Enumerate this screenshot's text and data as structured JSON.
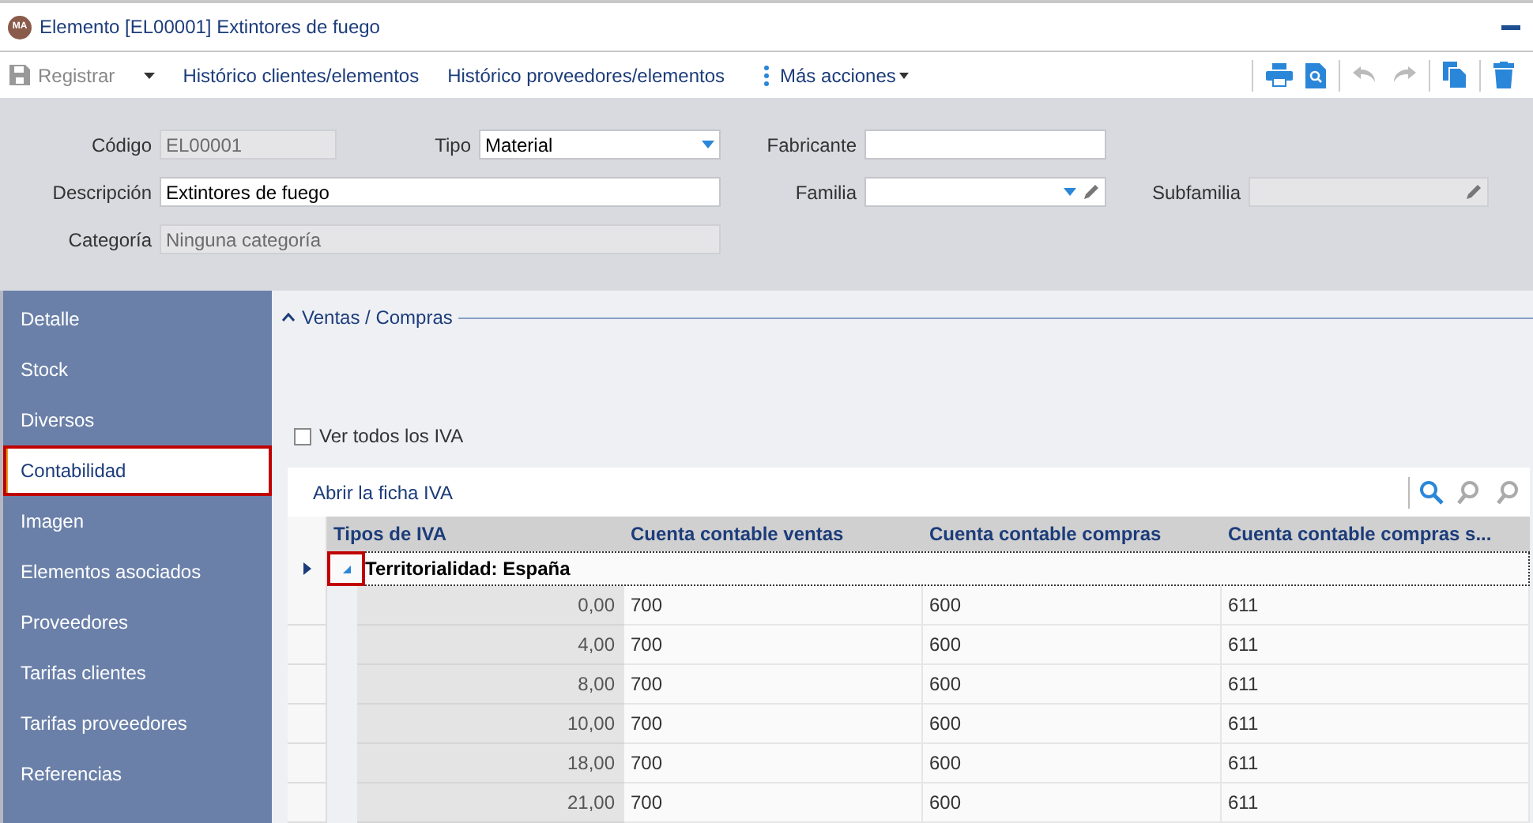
{
  "window": {
    "title": "Elemento [EL00001] Extintores de fuego",
    "avatar": "MA"
  },
  "toolbar": {
    "register": "Registrar",
    "actions": [
      "Histórico clientes/elementos",
      "Histórico proveedores/elementos"
    ],
    "more": "Más acciones"
  },
  "form": {
    "codigo": {
      "label": "Código",
      "value": "EL00001",
      "disabled": true
    },
    "tipo": {
      "label": "Tipo",
      "value": "Material"
    },
    "fabricante": {
      "label": "Fabricante"
    },
    "descripcion": {
      "label": "Descripción",
      "value": "Extintores de fuego"
    },
    "familia": {
      "label": "Familia"
    },
    "subfamilia": {
      "label": "Subfamilia",
      "disabled": true
    },
    "categoria": {
      "label": "Categoría",
      "value": "Ninguna categoría",
      "disabled": true
    }
  },
  "sidebar": {
    "items": [
      {
        "label": "Detalle",
        "selected": false
      },
      {
        "label": "Stock",
        "selected": false
      },
      {
        "label": "Diversos",
        "selected": false
      },
      {
        "label": "Contabilidad",
        "selected": true
      },
      {
        "label": "Imagen",
        "selected": false
      },
      {
        "label": "Elementos asociados",
        "selected": false
      },
      {
        "label": "Proveedores",
        "selected": false
      },
      {
        "label": "Tarifas clientes",
        "selected": false
      },
      {
        "label": "Tarifas proveedores",
        "selected": false
      },
      {
        "label": "Referencias",
        "selected": false
      }
    ]
  },
  "section": {
    "title": "Ventas / Compras",
    "expanded": true
  },
  "show_all": {
    "label": "Ver todos los IVA",
    "checked": false
  },
  "grid_toolbar": {
    "open": "Abrir la ficha IVA"
  },
  "table": {
    "columns": [
      "Tipos de IVA",
      "Cuenta contable ventas",
      "Cuenta contable compras",
      "Cuenta contable compras s..."
    ],
    "group": {
      "label": "Territorialidad: España",
      "expanded": true
    },
    "rows": [
      [
        "0,00",
        "700",
        "600",
        "611"
      ],
      [
        "4,00",
        "700",
        "600",
        "611"
      ],
      [
        "8,00",
        "700",
        "600",
        "611"
      ],
      [
        "10,00",
        "700",
        "600",
        "611"
      ],
      [
        "18,00",
        "700",
        "600",
        "611"
      ],
      [
        "21,00",
        "700",
        "600",
        "611"
      ]
    ]
  }
}
